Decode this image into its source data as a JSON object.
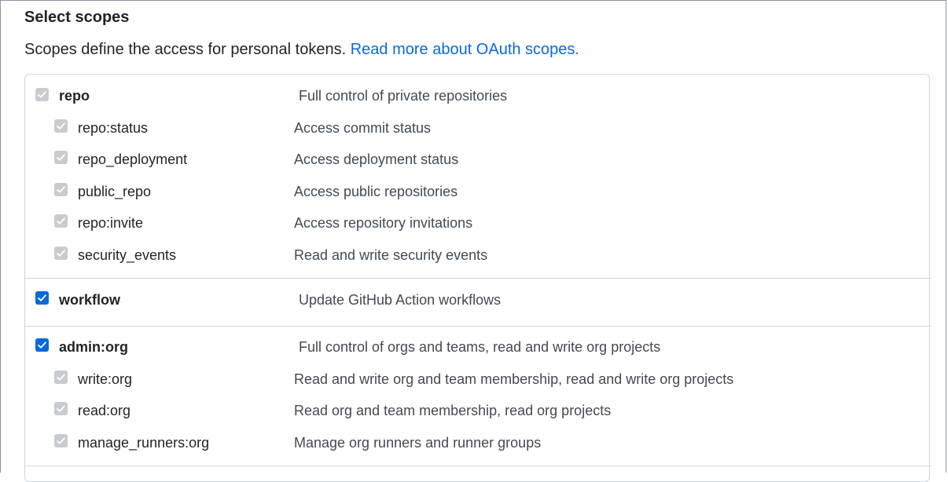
{
  "header": {
    "title": "Select scopes",
    "description": "Scopes define the access for personal tokens.",
    "link_text": "Read more about OAuth scopes."
  },
  "colors": {
    "accent": "#0969da",
    "disabled_check": "#c8cbcf",
    "border": "#d0d7de"
  },
  "groups": [
    {
      "name": "repo",
      "description": "Full control of private repositories",
      "state": "checked-disabled",
      "children": [
        {
          "name": "repo:status",
          "description": "Access commit status",
          "state": "checked-disabled"
        },
        {
          "name": "repo_deployment",
          "description": "Access deployment status",
          "state": "checked-disabled"
        },
        {
          "name": "public_repo",
          "description": "Access public repositories",
          "state": "checked-disabled"
        },
        {
          "name": "repo:invite",
          "description": "Access repository invitations",
          "state": "checked-disabled"
        },
        {
          "name": "security_events",
          "description": "Read and write security events",
          "state": "checked-disabled"
        }
      ]
    },
    {
      "name": "workflow",
      "description": "Update GitHub Action workflows",
      "state": "checked",
      "children": []
    },
    {
      "name": "admin:org",
      "description": "Full control of orgs and teams, read and write org projects",
      "state": "checked",
      "children": [
        {
          "name": "write:org",
          "description": "Read and write org and team membership, read and write org projects",
          "state": "checked-disabled"
        },
        {
          "name": "read:org",
          "description": "Read org and team membership, read org projects",
          "state": "checked-disabled"
        },
        {
          "name": "manage_runners:org",
          "description": "Manage org runners and runner groups",
          "state": "checked-disabled"
        }
      ]
    }
  ]
}
